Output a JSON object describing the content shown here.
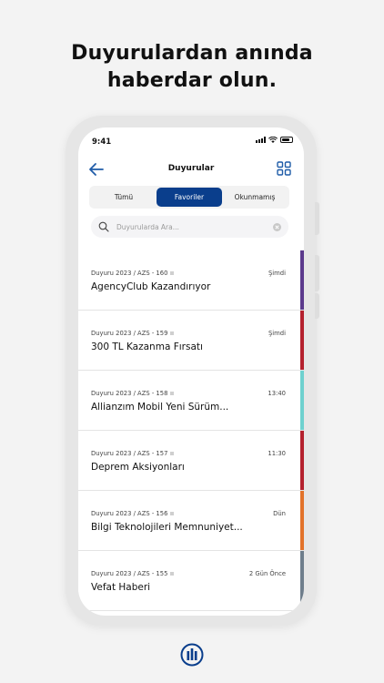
{
  "headline": {
    "line1": "Duyurulardan anında",
    "line2": "haberdar olun."
  },
  "status": {
    "time": "9:41"
  },
  "nav": {
    "title": "Duyurular"
  },
  "tabs": [
    {
      "label": "Tümü",
      "active": false
    },
    {
      "label": "Favoriler",
      "active": true
    },
    {
      "label": "Okunmamış",
      "active": false
    }
  ],
  "search": {
    "placeholder": "Duyurularda Ara..."
  },
  "announcements": [
    {
      "meta": "Duyuru 2023 / AZS - 160",
      "title": "AgencyClub Kazandırıyor",
      "time": "Şimdi",
      "color": "#5b3a8c"
    },
    {
      "meta": "Duyuru 2023 / AZS - 159",
      "title": "300 TL Kazanma Fırsatı",
      "time": "Şimdi",
      "color": "#b4212e"
    },
    {
      "meta": "Duyuru 2023 / AZS - 158",
      "title": "Allianzım Mobil Yeni Sürüm...",
      "time": "13:40",
      "color": "#6fd1cf"
    },
    {
      "meta": "Duyuru 2023 / AZS - 157",
      "title": "Deprem Aksiyonları",
      "time": "11:30",
      "color": "#b4212e"
    },
    {
      "meta": "Duyuru 2023 / AZS - 156",
      "title": "Bilgi Teknolojileri Memnuniyet...",
      "time": "Dün",
      "color": "#e2732b"
    },
    {
      "meta": "Duyuru 2023 / AZS - 155",
      "title": "Vefat Haberi",
      "time": "2 Gün Önce",
      "color": "#6f7e8c"
    }
  ],
  "colors": {
    "brand": "#0a3e8c",
    "accent_icon": "#1f5ca8"
  },
  "icons": {
    "back": "arrow-left-icon",
    "grid": "grid-icon",
    "search": "search-icon",
    "clear": "clear-icon",
    "logo": "allianz-logo-icon"
  }
}
